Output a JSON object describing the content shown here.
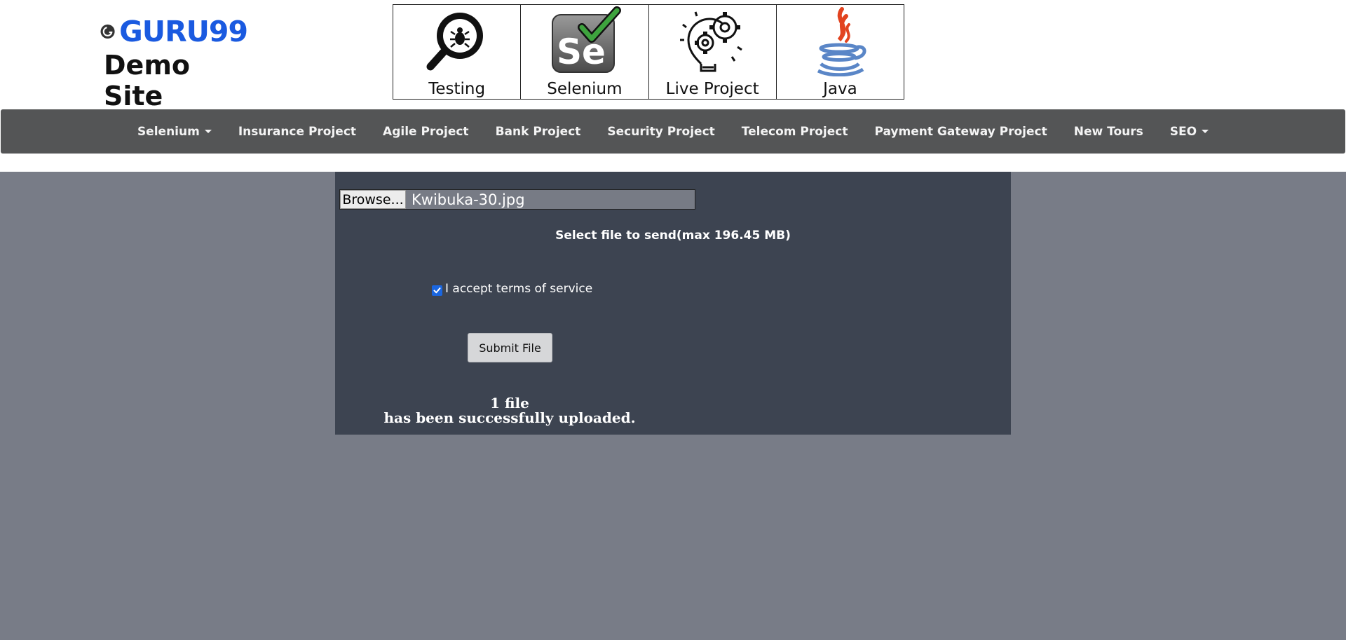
{
  "header": {
    "logo_text": "GURU99",
    "site_title": "Demo Site",
    "tiles": [
      {
        "label": "Testing",
        "icon": "magnifier-bug-icon"
      },
      {
        "label": "Selenium",
        "icon": "selenium-icon"
      },
      {
        "label": "Live Project",
        "icon": "lightbulb-gears-icon"
      },
      {
        "label": "Java",
        "icon": "java-icon"
      }
    ]
  },
  "nav": {
    "items": [
      {
        "label": "Selenium",
        "dropdown": true
      },
      {
        "label": "Insurance Project",
        "dropdown": false
      },
      {
        "label": "Agile Project",
        "dropdown": false
      },
      {
        "label": "Bank Project",
        "dropdown": false
      },
      {
        "label": "Security Project",
        "dropdown": false
      },
      {
        "label": "Telecom Project",
        "dropdown": false
      },
      {
        "label": "Payment Gateway Project",
        "dropdown": false
      },
      {
        "label": "New Tours",
        "dropdown": false
      },
      {
        "label": "SEO",
        "dropdown": true
      }
    ]
  },
  "upload": {
    "browse_label": "Browse...",
    "file_name": "Kwibuka-30.jpg",
    "hint": "Select file to send(max 196.45 MB)",
    "terms_label": "I accept terms of service",
    "terms_checked": true,
    "submit_label": "Submit File",
    "result_line1": "1 file",
    "result_line2": "has been successfully uploaded."
  },
  "colors": {
    "navbar": "#545556",
    "page_bg": "#787c87",
    "panel_bg": "#3d4451",
    "logo_blue": "#1a5ae0",
    "checkbox": "#1a66e0"
  }
}
